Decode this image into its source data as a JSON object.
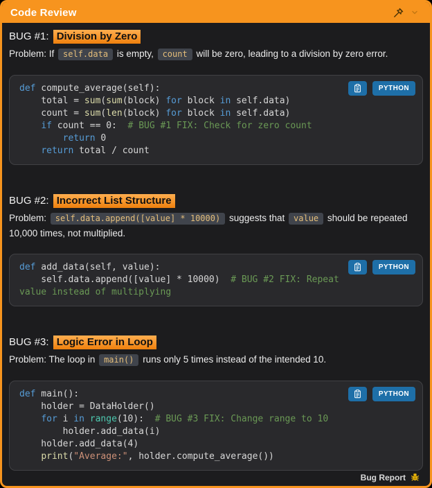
{
  "window": {
    "title": "Code Review"
  },
  "colors": {
    "header": "#F7941E",
    "title_highlight_top": "#FFAE4F",
    "title_highlight_bottom": "#EE800D",
    "badge_blue": "#1E6FA8",
    "chip_bg": "#40444C",
    "chip_text": "#E5BE7A",
    "keyword": "#569CD6",
    "function": "#DCDCAA",
    "builtin": "#4EC9B0",
    "comment": "#6A9955",
    "string": "#CE9178"
  },
  "icons": {
    "pin": "pushpin-icon",
    "collapse": "chevron-down-icon",
    "copy": "clipboard-icon",
    "bug": "bug-icon"
  },
  "footer": {
    "label": "Bug Report"
  },
  "bugs": [
    {
      "label": "BUG #1:",
      "title": "Division by Zero",
      "problem": [
        {
          "t": "text",
          "v": "Problem: If "
        },
        {
          "t": "code",
          "v": "self.data"
        },
        {
          "t": "text",
          "v": " is empty, "
        },
        {
          "t": "code",
          "v": "count"
        },
        {
          "t": "text",
          "v": " will be zero, leading to a division by zero error."
        }
      ],
      "code": {
        "language": "PYTHON",
        "lines": [
          [
            {
              "c": "kw",
              "v": "def"
            },
            {
              "c": "txt",
              "v": " compute_average(self):"
            }
          ],
          [
            {
              "c": "txt",
              "v": "    total = "
            },
            {
              "c": "fn",
              "v": "sum"
            },
            {
              "c": "txt",
              "v": "("
            },
            {
              "c": "fn",
              "v": "sum"
            },
            {
              "c": "txt",
              "v": "(block) "
            },
            {
              "c": "kw",
              "v": "for"
            },
            {
              "c": "txt",
              "v": " block "
            },
            {
              "c": "kw",
              "v": "in"
            },
            {
              "c": "txt",
              "v": " self.data)"
            }
          ],
          [
            {
              "c": "txt",
              "v": "    count = "
            },
            {
              "c": "fn",
              "v": "sum"
            },
            {
              "c": "txt",
              "v": "("
            },
            {
              "c": "fn",
              "v": "len"
            },
            {
              "c": "txt",
              "v": "(block) "
            },
            {
              "c": "kw",
              "v": "for"
            },
            {
              "c": "txt",
              "v": " block "
            },
            {
              "c": "kw",
              "v": "in"
            },
            {
              "c": "txt",
              "v": " self.data)"
            }
          ],
          [
            {
              "c": "txt",
              "v": "    "
            },
            {
              "c": "kw",
              "v": "if"
            },
            {
              "c": "txt",
              "v": " count == 0:  "
            },
            {
              "c": "com",
              "v": "# BUG #1 FIX: Check for zero count"
            }
          ],
          [
            {
              "c": "txt",
              "v": "        "
            },
            {
              "c": "kw",
              "v": "return"
            },
            {
              "c": "txt",
              "v": " 0"
            }
          ],
          [
            {
              "c": "txt",
              "v": "    "
            },
            {
              "c": "kw",
              "v": "return"
            },
            {
              "c": "txt",
              "v": " total / count"
            }
          ]
        ]
      }
    },
    {
      "label": "BUG #2:",
      "title": "Incorrect List Structure",
      "problem": [
        {
          "t": "text",
          "v": "Problem: "
        },
        {
          "t": "code",
          "v": "self.data.append([value] * 10000)"
        },
        {
          "t": "text",
          "v": " suggests that "
        },
        {
          "t": "code",
          "v": "value"
        },
        {
          "t": "text",
          "v": " should be repeated 10,000 times, not multiplied."
        }
      ],
      "code": {
        "language": "PYTHON",
        "lines": [
          [
            {
              "c": "kw",
              "v": "def"
            },
            {
              "c": "txt",
              "v": " add_data(self, value):"
            }
          ],
          [
            {
              "c": "txt",
              "v": "    self.data.append([value] * 10000)  "
            },
            {
              "c": "com",
              "v": "# BUG #2 FIX: Repeat"
            }
          ],
          [
            {
              "c": "com",
              "v": "value instead of multiplying"
            }
          ]
        ]
      }
    },
    {
      "label": "BUG #3:",
      "title": "Logic Error in Loop",
      "problem": [
        {
          "t": "text",
          "v": "Problem: The loop in "
        },
        {
          "t": "code",
          "v": "main()"
        },
        {
          "t": "text",
          "v": " runs only 5 times instead of the intended 10."
        }
      ],
      "code": {
        "language": "PYTHON",
        "lines": [
          [
            {
              "c": "kw",
              "v": "def"
            },
            {
              "c": "txt",
              "v": " main():"
            }
          ],
          [
            {
              "c": "txt",
              "v": "    holder = DataHolder()"
            }
          ],
          [
            {
              "c": "txt",
              "v": "    "
            },
            {
              "c": "kw",
              "v": "for"
            },
            {
              "c": "txt",
              "v": " i "
            },
            {
              "c": "kw",
              "v": "in"
            },
            {
              "c": "txt",
              "v": " "
            },
            {
              "c": "cls",
              "v": "range"
            },
            {
              "c": "txt",
              "v": "(10):  "
            },
            {
              "c": "com",
              "v": "# BUG #3 FIX: Change range to 10"
            }
          ],
          [
            {
              "c": "txt",
              "v": "        holder.add_data(i)"
            }
          ],
          [
            {
              "c": "txt",
              "v": "    holder.add_data(4)"
            }
          ],
          [
            {
              "c": "txt",
              "v": "    "
            },
            {
              "c": "fn",
              "v": "print"
            },
            {
              "c": "txt",
              "v": "("
            },
            {
              "c": "str",
              "v": "\"Average:\""
            },
            {
              "c": "txt",
              "v": ", holder.compute_average())"
            }
          ]
        ]
      }
    }
  ]
}
